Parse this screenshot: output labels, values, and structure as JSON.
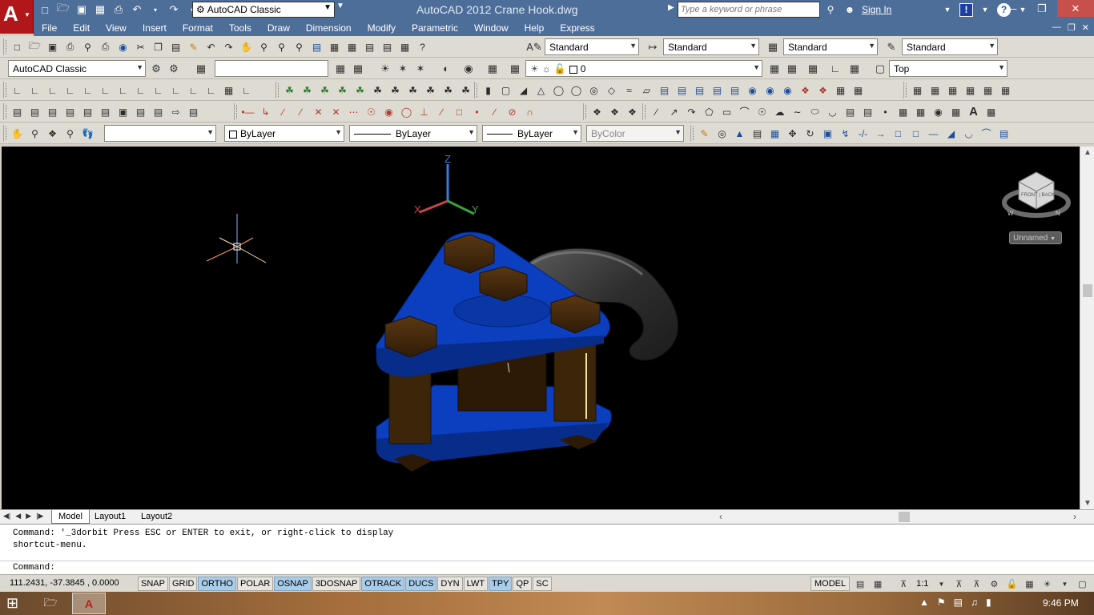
{
  "app": {
    "window_title": "AutoCAD 2012    Crane Hook.dwg",
    "workspace": "AutoCAD Classic",
    "search_placeholder": "Type a keyword or phrase",
    "sign_in": "Sign In"
  },
  "menubar": {
    "items": [
      "File",
      "Edit",
      "View",
      "Insert",
      "Format",
      "Tools",
      "Draw",
      "Dimension",
      "Modify",
      "Parametric",
      "Window",
      "Help",
      "Express"
    ]
  },
  "styles_toolbar": {
    "text_style": "Standard",
    "dim_style": "Standard",
    "table_style": "Standard",
    "mleader_style": "Standard"
  },
  "workspaces_toolbar": {
    "workspace": "AutoCAD Classic",
    "layer": "0",
    "view": "Top"
  },
  "properties_toolbar": {
    "color": "ByLayer",
    "linetype": "ByLayer",
    "lineweight": "ByLayer",
    "plotstyle": "ByColor"
  },
  "viewport": {
    "ucs_z": "Z",
    "ucs_y": "Y",
    "ucs_x": "X",
    "viewcube_face": "FRONT | BACK",
    "compass_w": "W",
    "compass_n": "N",
    "ucs_menu": "Unnamed"
  },
  "layout_tabs": [
    "Model",
    "Layout1",
    "Layout2"
  ],
  "command": {
    "history_line1": "Command: '_3dorbit Press ESC or ENTER to exit, or right-click to display",
    "history_line2": "shortcut-menu.",
    "prompt": "Command:"
  },
  "status": {
    "coordinates": "111.2431, -37.3845 , 0.0000",
    "toggles": [
      {
        "label": "SNAP",
        "on": false
      },
      {
        "label": "GRID",
        "on": false
      },
      {
        "label": "ORTHO",
        "on": true
      },
      {
        "label": "POLAR",
        "on": false
      },
      {
        "label": "OSNAP",
        "on": true
      },
      {
        "label": "3DOSNAP",
        "on": false
      },
      {
        "label": "OTRACK",
        "on": true
      },
      {
        "label": "DUCS",
        "on": true
      },
      {
        "label": "DYN",
        "on": false
      },
      {
        "label": "LWT",
        "on": false
      },
      {
        "label": "TPY",
        "on": true
      },
      {
        "label": "QP",
        "on": false
      },
      {
        "label": "SC",
        "on": false
      }
    ],
    "model": "MODEL",
    "annotation_scale": "1:1"
  },
  "taskbar": {
    "clock": "9:46 PM"
  },
  "colors": {
    "titlebar": "#4e6e9a",
    "viewport_bg": "#000000",
    "plate_blue": "#0b3fbf",
    "nut_brown": "#4a2c0f",
    "hook_grey": "#3a3a3a"
  }
}
